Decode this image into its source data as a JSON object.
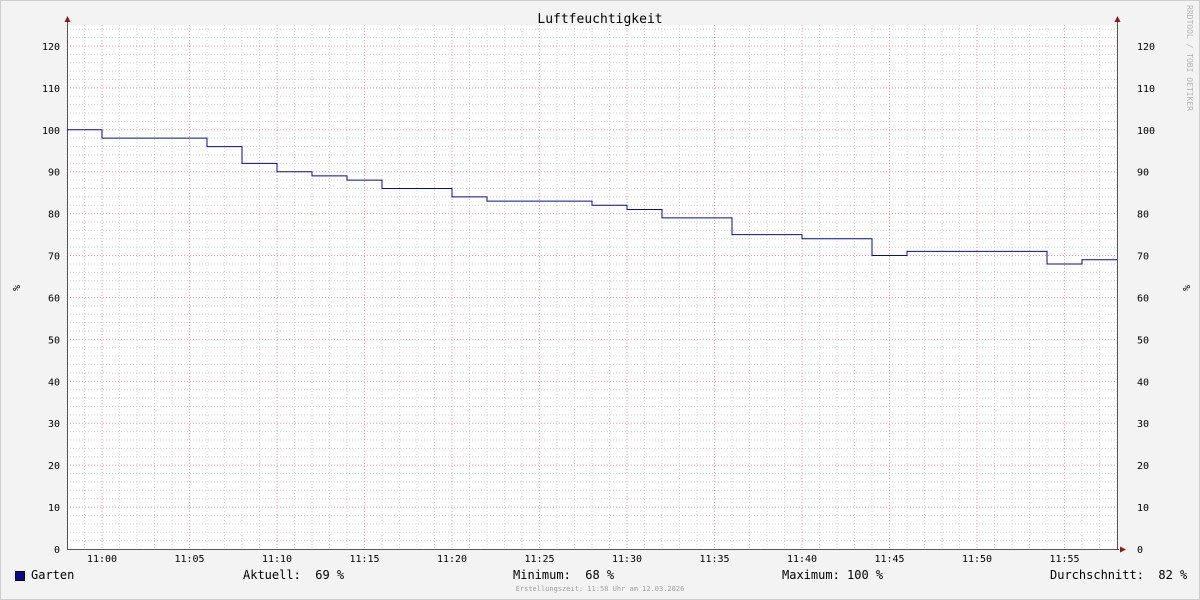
{
  "chart_data": {
    "type": "line",
    "title": "Luftfeuchtigkeit",
    "ylabel": "%",
    "ylim": [
      0,
      125
    ],
    "yticks": [
      0,
      10,
      20,
      30,
      40,
      50,
      60,
      70,
      80,
      90,
      100,
      110,
      120
    ],
    "xlim": [
      "10:58",
      "11:58"
    ],
    "xticks": [
      "11:00",
      "11:05",
      "11:10",
      "11:15",
      "11:20",
      "11:25",
      "11:30",
      "11:35",
      "11:40",
      "11:45",
      "11:50",
      "11:55"
    ],
    "line_shape": "step",
    "grid": true,
    "series": [
      {
        "name": "Garten",
        "color": "#0a0a8c",
        "x": [
          "10:58",
          "11:00",
          "11:02",
          "11:06",
          "11:08",
          "11:10",
          "11:12",
          "11:14",
          "11:16",
          "11:18",
          "11:20",
          "11:22",
          "11:28",
          "11:30",
          "11:32",
          "11:36",
          "11:40",
          "11:44",
          "11:46",
          "11:54",
          "11:56",
          "11:58"
        ],
        "values": [
          100,
          98,
          98,
          96,
          92,
          90,
          89,
          88,
          86,
          86,
          84,
          83,
          82,
          81,
          79,
          75,
          74,
          70,
          71,
          68,
          69,
          69
        ]
      }
    ],
    "watermark": "RRDTOOL / TOBI OETIKER"
  },
  "legend": {
    "series_name": "Garten",
    "current": "Aktuell:  69 %",
    "minimum": "Minimum:  68 %",
    "maximum": "Maximum: 100 %",
    "average": "Durchschnitt:  82 %"
  },
  "footer": "Erstellungszeit: 11:58 Uhr am 12.03.2026",
  "colors": {
    "background": "#f3f3f3",
    "plot_background": "#ffffff",
    "major_grid": "#e8a0a0",
    "minor_grid": "#d8d8d8",
    "axis": "#555555",
    "arrow": "#8b1a1a"
  }
}
